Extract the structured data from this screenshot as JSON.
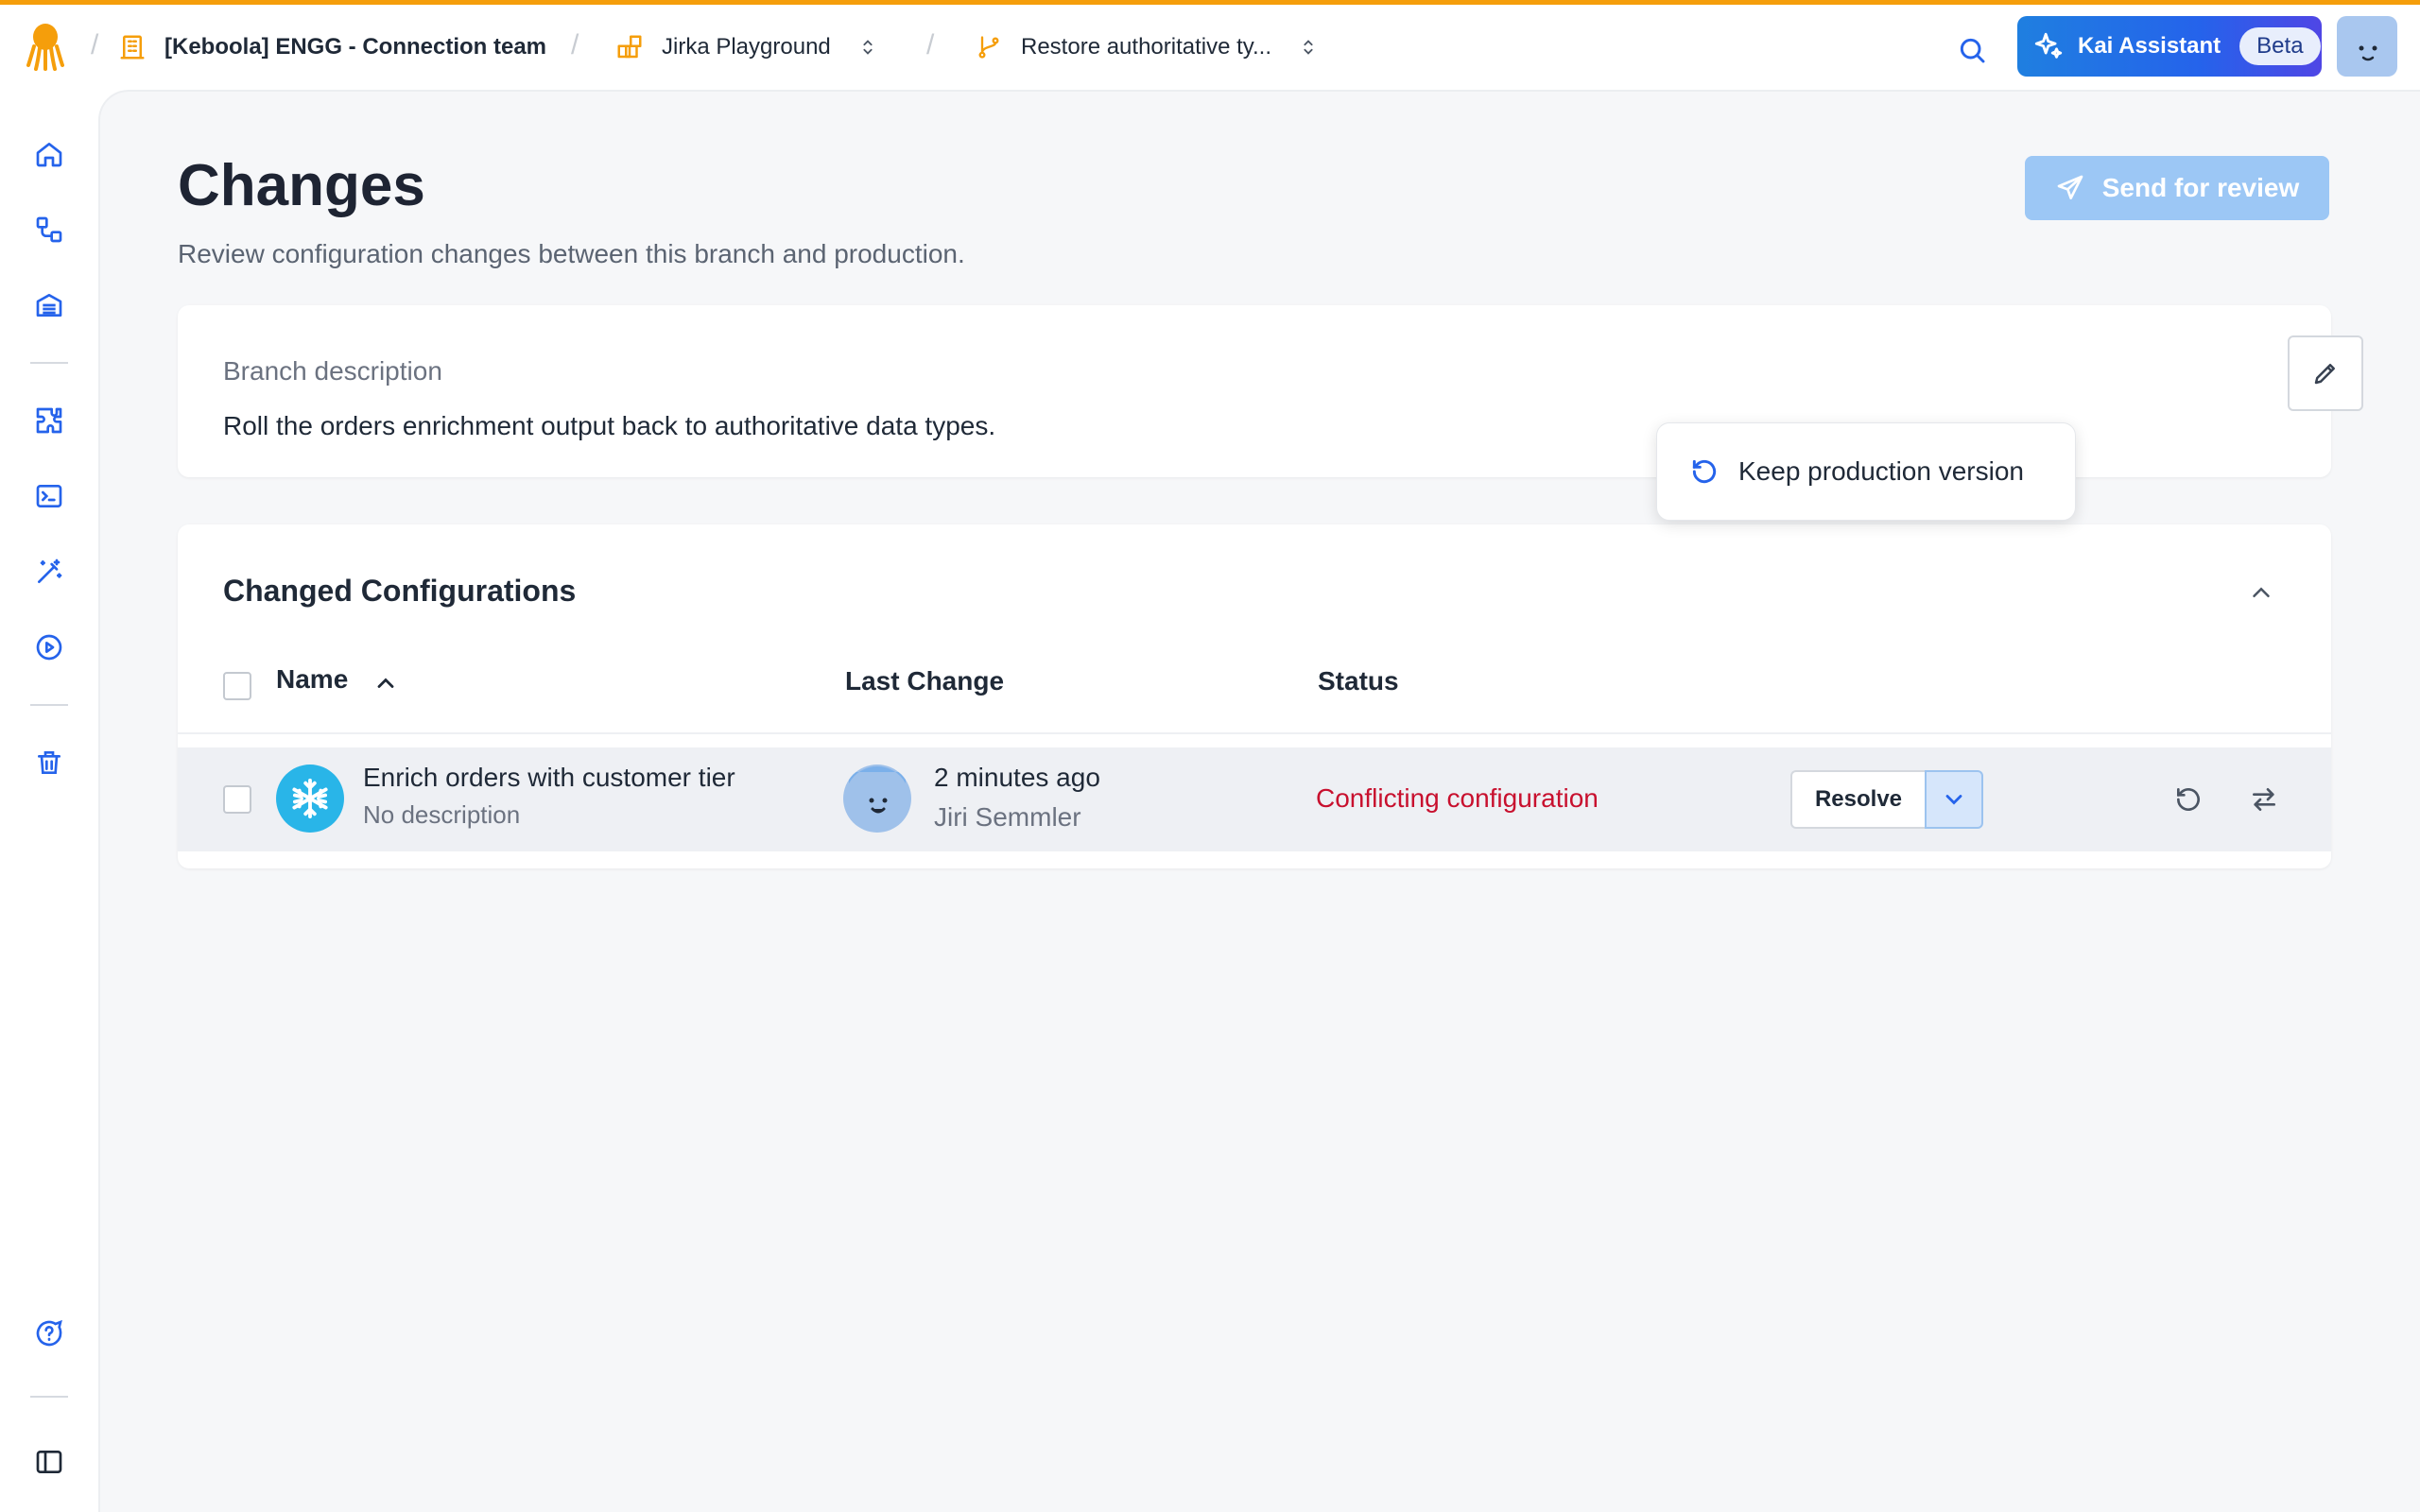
{
  "topbar": {
    "org": "[Keboola] ENGG - Connection team",
    "project": "Jirka Playground",
    "branch": "Restore authoritative ty...",
    "kai_label": "Kai Assistant",
    "kai_badge": "Beta"
  },
  "sidebar": {
    "items": [
      "home-icon",
      "flows-icon",
      "storage-icon",
      "components-icon",
      "terminal-icon",
      "magic-wand-icon",
      "jobs-icon",
      "trash-icon",
      "help-icon",
      "sidebar-toggle-icon"
    ]
  },
  "page": {
    "title": "Changes",
    "subtitle": "Review configuration changes between this branch and production.",
    "send_label": "Send for review"
  },
  "branch_description": {
    "label": "Branch description",
    "text": "Roll the orders enrichment output back to authoritative data types."
  },
  "changed_configs": {
    "title": "Changed Configurations",
    "columns": {
      "name": "Name",
      "last_change": "Last Change",
      "status": "Status"
    },
    "rows": [
      {
        "name": "Enrich orders with customer tier",
        "description": "No description",
        "time": "2 minutes ago",
        "user": "Jiri Semmler",
        "status": "Conflicting configuration",
        "resolve_label": "Resolve"
      }
    ],
    "dropdown": {
      "item": "Keep production version"
    }
  },
  "colors": {
    "accent": "#f59e0b",
    "primary": "#2563eb",
    "conflict": "#c8102e",
    "snowflake": "#29b5e8"
  }
}
